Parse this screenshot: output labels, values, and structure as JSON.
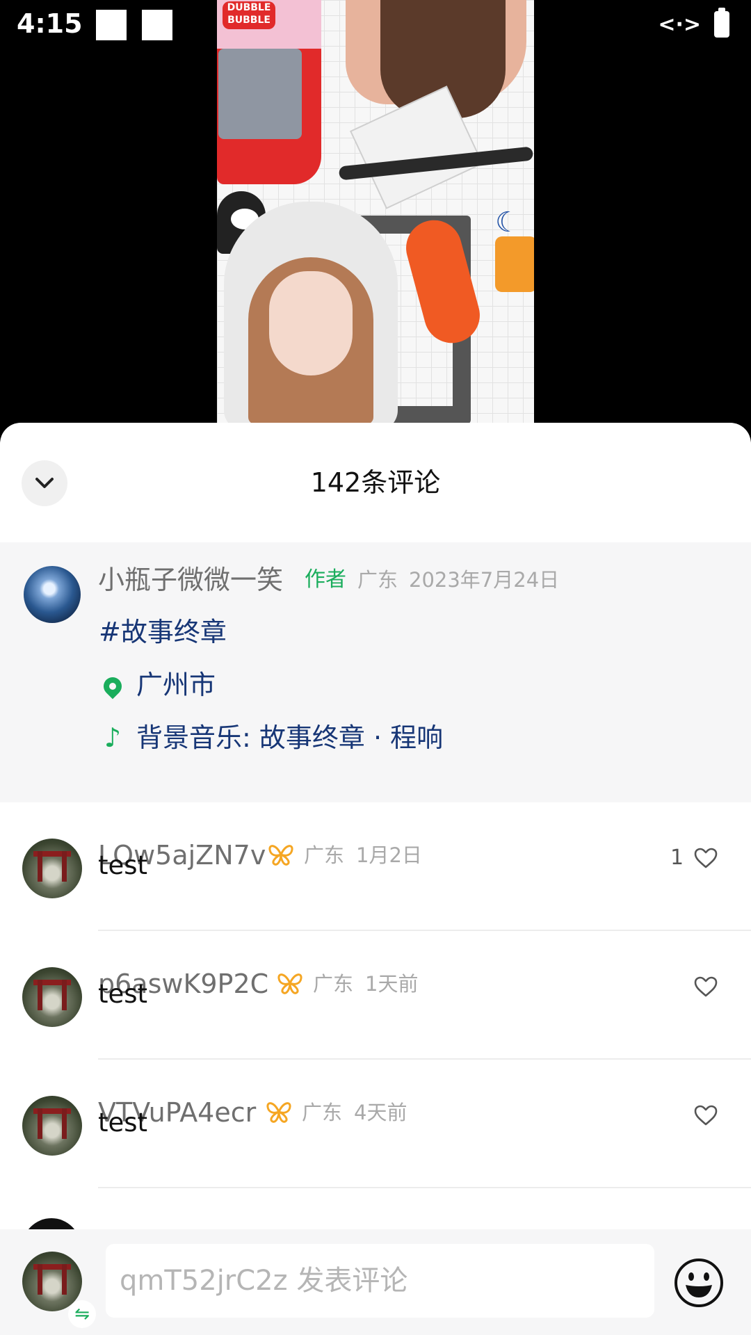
{
  "status_bar": {
    "time": "4:15",
    "indicator": "<·>"
  },
  "sheet": {
    "title": "142条评论",
    "collapse_icon": "chevron-down-icon"
  },
  "author_post": {
    "name": "小瓶子微微一笑",
    "badge": "作者",
    "region": "广东",
    "date": "2023年7月24日",
    "hashtag": "#故事终章",
    "location": "广州市",
    "music": "背景音乐: 故事终章 · 程响"
  },
  "comments": [
    {
      "user": "LQw5ajZN7v",
      "region": "广东",
      "time": "1月2日",
      "text": "test",
      "likes": "1"
    },
    {
      "user": "p6aswK9P2C",
      "region": "广东",
      "time": "1天前",
      "text": "test",
      "likes": ""
    },
    {
      "user": "VTVuPA4ecr",
      "region": "广东",
      "time": "4天前",
      "text": "test",
      "likes": ""
    }
  ],
  "input_bar": {
    "placeholder": "qmT52jrC2z 发表评论",
    "switch_glyph": "⇋"
  },
  "colors": {
    "accent_green": "#1aad5c",
    "link_blue": "#173676",
    "butterfly_orange": "#f5a623"
  }
}
